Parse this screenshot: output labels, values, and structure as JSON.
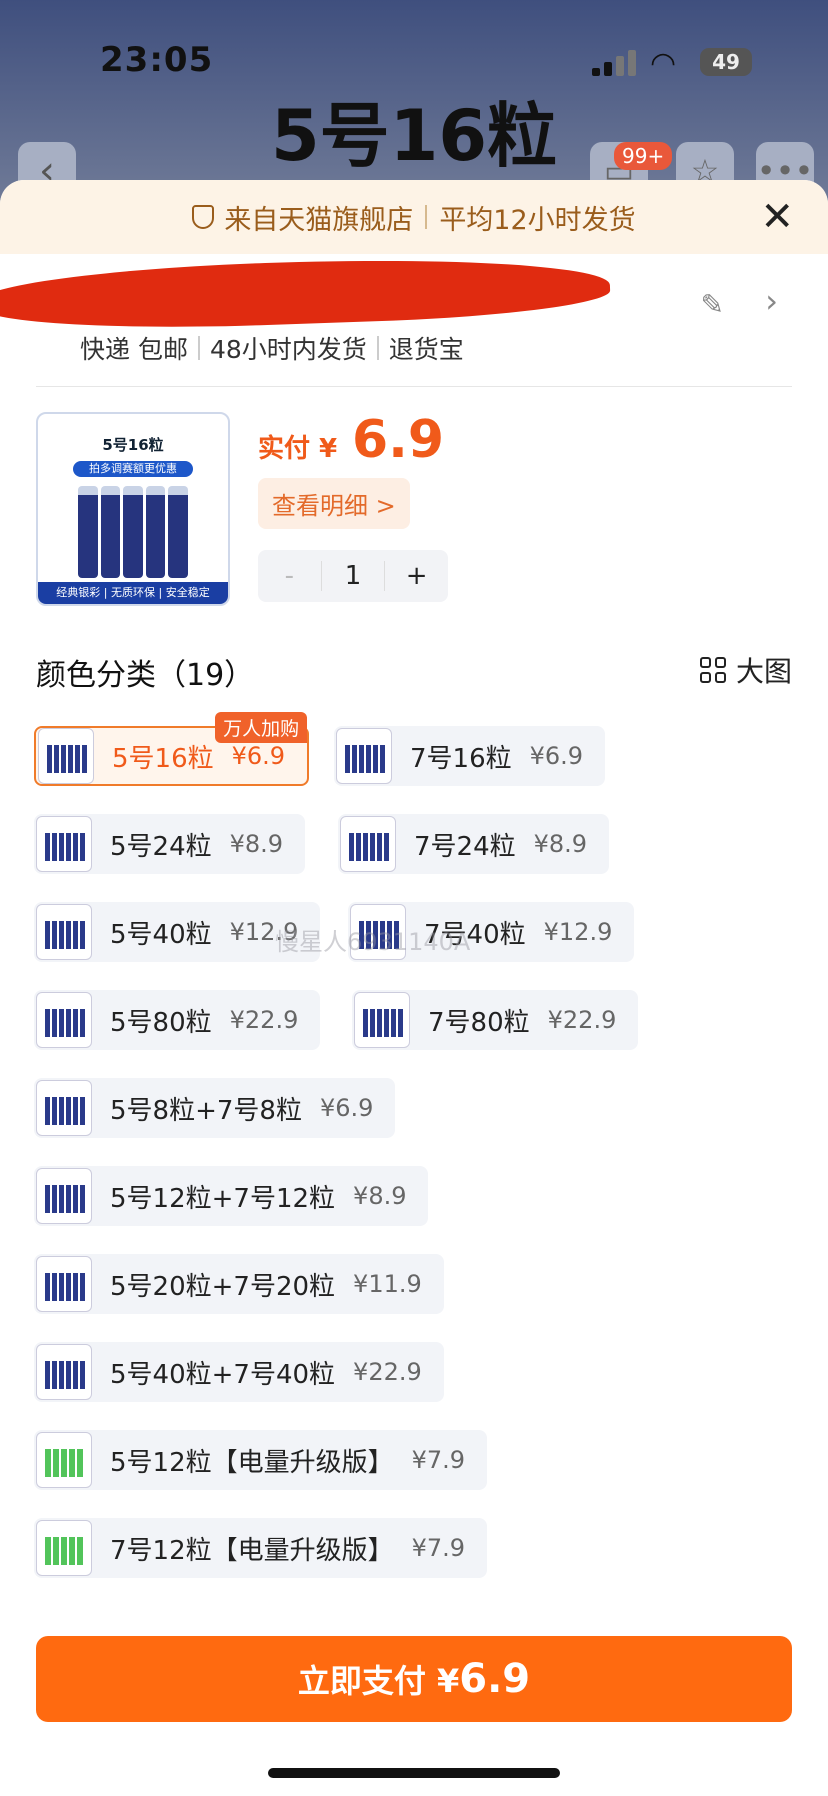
{
  "status": {
    "time": "23:05",
    "battery": "49"
  },
  "background": {
    "title": "5号16粒",
    "cart_badge": "99+"
  },
  "banner": {
    "text1": "来自天猫旗舰店",
    "text2": "平均12小时发货"
  },
  "shipping": {
    "items": [
      "快递 包邮",
      "48小时内发货",
      "退货宝"
    ]
  },
  "product": {
    "image_title": "5号16粒",
    "image_banner": "拍多调赛额更优惠",
    "image_footer": "经典银彩 | 无质环保 | 安全稳定",
    "pay_label": "实付 ¥",
    "pay_price": "6.9",
    "detail_button": "查看明细 >",
    "quantity": "1"
  },
  "category": {
    "title": "颜色分类（19）",
    "big_view": "大图"
  },
  "options": [
    {
      "label": "5号16粒",
      "price": "¥6.9",
      "selected": true,
      "badge": "万人加购"
    },
    {
      "label": "7号16粒",
      "price": "¥6.9"
    },
    {
      "label": "5号24粒",
      "price": "¥8.9"
    },
    {
      "label": "7号24粒",
      "price": "¥8.9"
    },
    {
      "label": "5号40粒",
      "price": "¥12.9"
    },
    {
      "label": "7号40粒",
      "price": "¥12.9"
    },
    {
      "label": "5号80粒",
      "price": "¥22.9"
    },
    {
      "label": "7号80粒",
      "price": "¥22.9"
    },
    {
      "label": "5号8粒+7号8粒",
      "price": "¥6.9"
    },
    {
      "label": "5号12粒+7号12粒",
      "price": "¥8.9"
    },
    {
      "label": "5号20粒+7号20粒",
      "price": "¥11.9"
    },
    {
      "label": "5号40粒+7号40粒",
      "price": "¥22.9"
    },
    {
      "label": "5号12粒【电量升级版】",
      "price": "¥7.9"
    },
    {
      "label": "7号12粒【电量升级版】",
      "price": "¥7.9"
    }
  ],
  "pay_button": {
    "label": "立即支付 ¥",
    "amount": "6.9"
  },
  "watermark": "慢星人6931140A"
}
